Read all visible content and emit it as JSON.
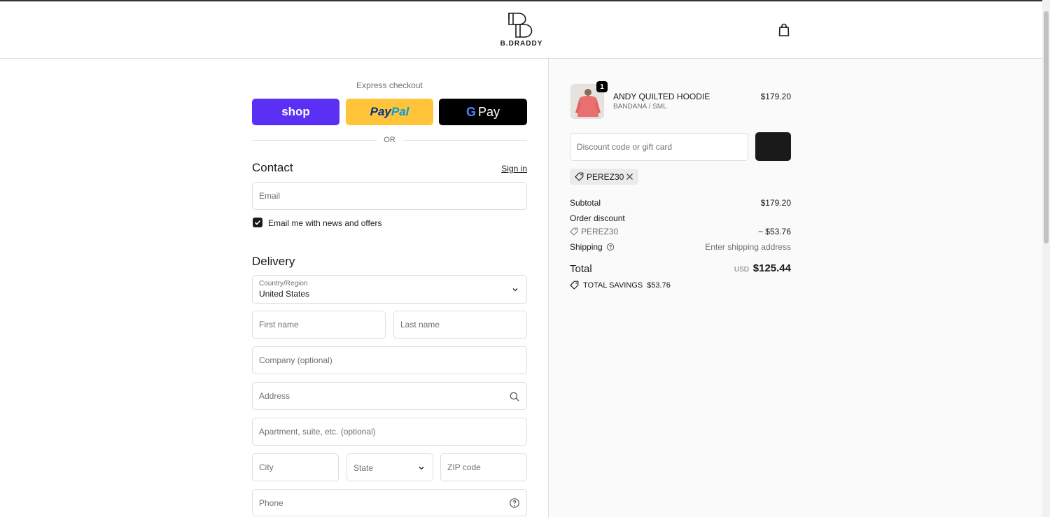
{
  "brand": {
    "logo_text": "B.DRADDY"
  },
  "express": {
    "label": "Express checkout",
    "shop_label": "shop",
    "paypal_label_1": "Pay",
    "paypal_label_2": "Pal",
    "gpay_label": "Pay",
    "or_label": "OR"
  },
  "contact": {
    "title": "Contact",
    "sign_in": "Sign in",
    "email_placeholder": "Email",
    "newsletter_label": "Email me with news and offers",
    "newsletter_checked": true
  },
  "delivery": {
    "title": "Delivery",
    "country_label": "Country/Region",
    "country_value": "United States",
    "first_name_placeholder": "First name",
    "last_name_placeholder": "Last name",
    "company_placeholder": "Company (optional)",
    "address_placeholder": "Address",
    "apartment_placeholder": "Apartment, suite, etc. (optional)",
    "city_placeholder": "City",
    "state_placeholder": "State",
    "zip_placeholder": "ZIP code",
    "phone_placeholder": "Phone"
  },
  "order": {
    "quantity": "1",
    "product_name": "ANDY QUILTED HOODIE",
    "product_variant": "BANDANA / SML",
    "product_price": "$179.20",
    "discount_placeholder": "Discount code or gift card",
    "applied_code": "PEREZ30",
    "subtotal_label": "Subtotal",
    "subtotal_value": "$179.20",
    "order_discount_label": "Order discount",
    "discount_code": "PEREZ30",
    "discount_value": "− $53.76",
    "shipping_label": "Shipping",
    "shipping_value": "Enter shipping address",
    "total_label": "Total",
    "total_currency": "USD",
    "total_value": "$125.44",
    "savings_label": "TOTAL SAVINGS",
    "savings_value": "$53.76"
  },
  "colors": {
    "shop_pay": "#5a31f4",
    "paypal": "#ffc439",
    "gpay": "#000000",
    "product_thumb": "#e87070"
  },
  "icons": [
    "bag-icon",
    "chevron-down-icon",
    "search-icon",
    "help-circle-icon",
    "tag-icon",
    "close-icon",
    "check-icon"
  ]
}
